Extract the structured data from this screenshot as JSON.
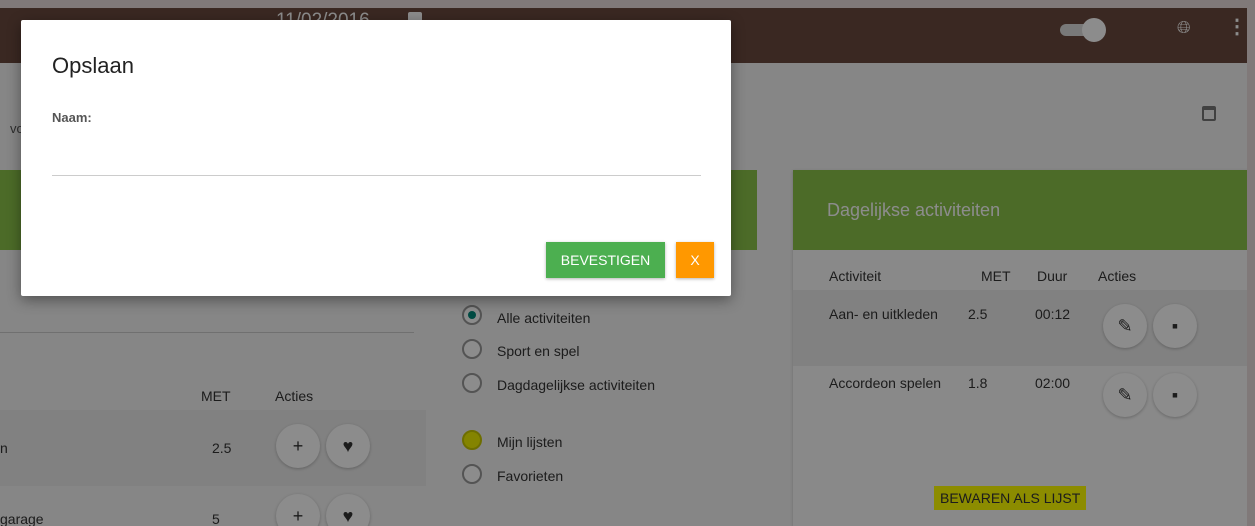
{
  "topbar": {
    "date": "11/02/2016",
    "icons": [
      "calendar-icon",
      "toggle-switch",
      "globe-icon",
      "more-vert-icon"
    ]
  },
  "page": {
    "partial_text": "vo"
  },
  "activities_table": {
    "headers": {
      "met": "MET",
      "actions": "Acties"
    },
    "rows": [
      {
        "name": "n",
        "met": "2.5"
      },
      {
        "name": "garage",
        "met": "5"
      }
    ]
  },
  "filters": {
    "options": [
      {
        "label": "Alle activiteiten",
        "checked": true
      },
      {
        "label": "Sport en spel",
        "checked": false
      },
      {
        "label": "Dagdagelijkse activiteiten",
        "checked": false
      }
    ],
    "lists": [
      {
        "label": "Mijn lijsten",
        "highlighted": true
      },
      {
        "label": "Favorieten",
        "highlighted": false
      }
    ]
  },
  "daily": {
    "title": "Dagelijkse activiteiten",
    "headers": {
      "activity": "Activiteit",
      "met": "MET",
      "duration": "Duur",
      "actions": "Acties"
    },
    "rows": [
      {
        "activity": "Aan- en uitkleden",
        "met": "2.5",
        "duration": "00:12"
      },
      {
        "activity": "Accordeon spelen",
        "met": "1.8",
        "duration": "02:00"
      }
    ],
    "save_list_label": "BEWAREN ALS LIJST"
  },
  "dialog": {
    "title": "Opslaan",
    "name_label": "Naam:",
    "name_value": "",
    "confirm_label": "BEVESTIGEN",
    "close_label": "X"
  },
  "colors": {
    "topbar": "#6b4a3e",
    "green": "#8bc34a",
    "confirm": "#4caf50",
    "close": "#ff9800",
    "highlight": "#ffff00"
  }
}
